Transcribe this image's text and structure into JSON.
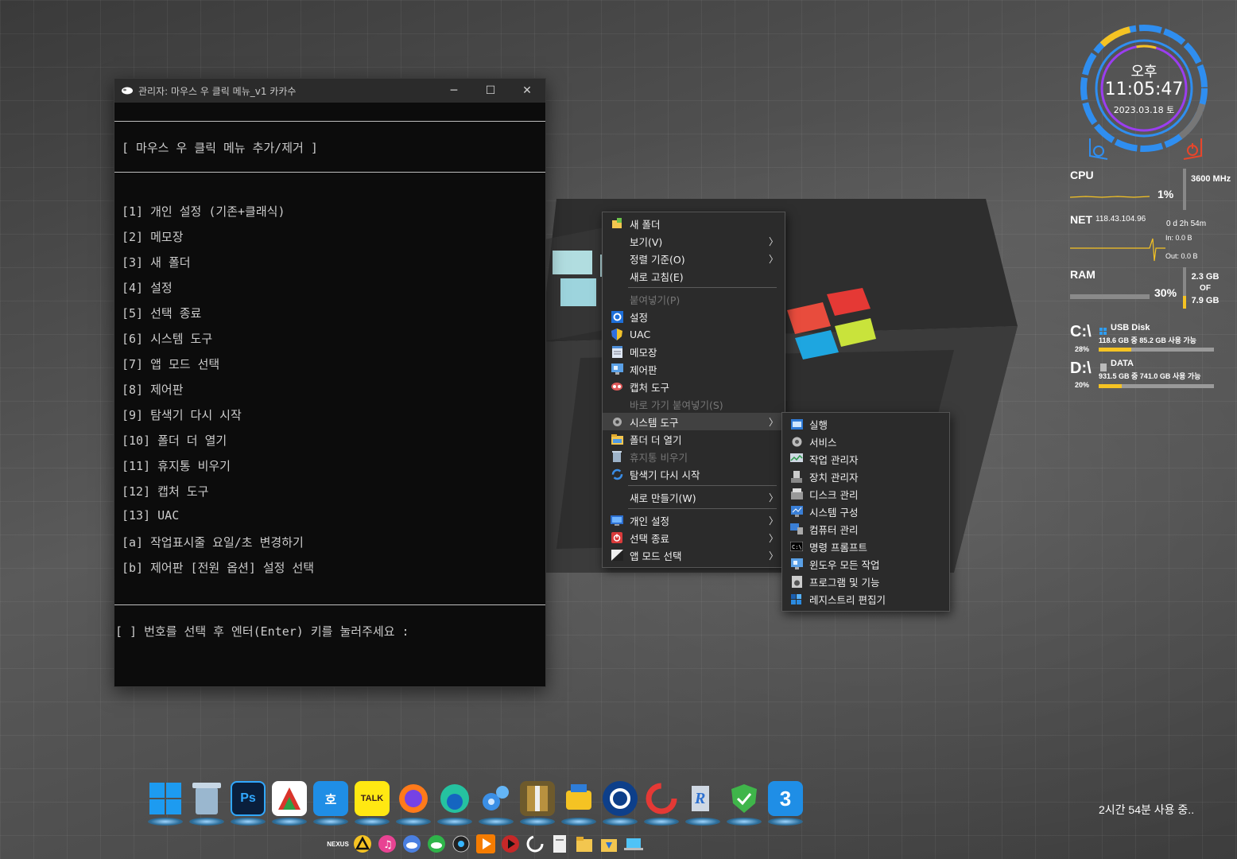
{
  "console": {
    "title": "관리자:  마우스 우 클릭 메뉴_v1 카카수",
    "header": "[ 마우스 우 클릭 메뉴 추가/제거 ]",
    "menu": [
      "[1] 개인 설정 (기존+클래식)",
      "[2] 메모장",
      "[3] 새 폴더",
      "[4] 설정",
      "[5] 선택 종료",
      "[6] 시스템 도구",
      "[7] 앱 모드 선택",
      "[8] 제어판",
      "[9] 탐색기 다시 시작",
      "[10] 폴더 더 열기",
      "[11] 휴지통 비우기",
      "[12] 캡처 도구",
      "[13] UAC",
      "[a] 작업표시줄 요일/초 변경하기",
      "[b] 제어판 [전원 옵션] 설정 선택"
    ],
    "prompt": "[ ] 번호를 선택 후 엔터(Enter) 키를 눌러주세요 :",
    "minimize": "─",
    "maximize": "☐",
    "close": "✕"
  },
  "context_menu": {
    "items": [
      "새 폴더",
      "보기(V)",
      "정렬 기준(O)",
      "새로 고침(E)",
      "붙여넣기(P)",
      "설정",
      "UAC",
      "메모장",
      "제어판",
      "캡처 도구",
      "바로 가기 붙여넣기(S)",
      "시스템 도구",
      "폴더 더 열기",
      "휴지통 비우기",
      "탐색기 다시 시작",
      "새로 만들기(W)",
      "개인 설정",
      "선택 종료",
      "앱 모드 선택"
    ],
    "arrow": "〉"
  },
  "submenu": {
    "items": [
      "실행",
      "서비스",
      "작업 관리자",
      "장치 관리자",
      "디스크 관리",
      "시스템 구성",
      "컴퓨터 관리",
      "명령 프롬프트",
      "윈도우 모든 작업",
      "프로그램 및 기능",
      "레지스트리 편집기"
    ]
  },
  "clock": {
    "ampm": "오후",
    "time": "11:05:47",
    "date": "2023.03.18 토"
  },
  "system": {
    "cpu_label": "CPU",
    "cpu_value": "1%",
    "cpu_freq": "3600 MHz",
    "net_label": "NET",
    "net_ip": "118.43.104.96",
    "uptime": "0 d 2h 54m",
    "net_in": "In: 0.0 B",
    "net_out": "Out: 0.0 B",
    "ram_label": "RAM",
    "ram_value": "30%",
    "ram_used": "2.3 GB",
    "ram_of": "OF",
    "ram_total": "7.9 GB",
    "ram_fraction": 0.3,
    "drives": [
      {
        "letter": "C:\\",
        "name": "USB Disk",
        "info": "118.6 GB 중 85.2 GB 사용 가능",
        "percent": "28%",
        "fraction": 0.28
      },
      {
        "letter": "D:\\",
        "name": "DATA",
        "info": "931.5 GB 중 741.0 GB 사용 가능",
        "percent": "20%",
        "fraction": 0.2
      }
    ]
  },
  "dock_icons": [
    "windows-icon",
    "recycle-bin-icon",
    "photoshop-icon",
    "office-icon",
    "hangul-icon",
    "kakaotalk-icon",
    "firefox-icon",
    "edge-icon",
    "settings-gears-icon",
    "archive-icon",
    "toolbox-icon",
    "cortana-icon",
    "ccleaner-icon",
    "registry-icon",
    "shield-check-icon",
    "three-icon"
  ],
  "dock_labels": {
    "ps": "Ps",
    "hangul": "호",
    "talk": "TALK",
    "three": "3"
  },
  "tray_label": "NEXUS",
  "usage_text": "2시간 54분 사용 중.."
}
